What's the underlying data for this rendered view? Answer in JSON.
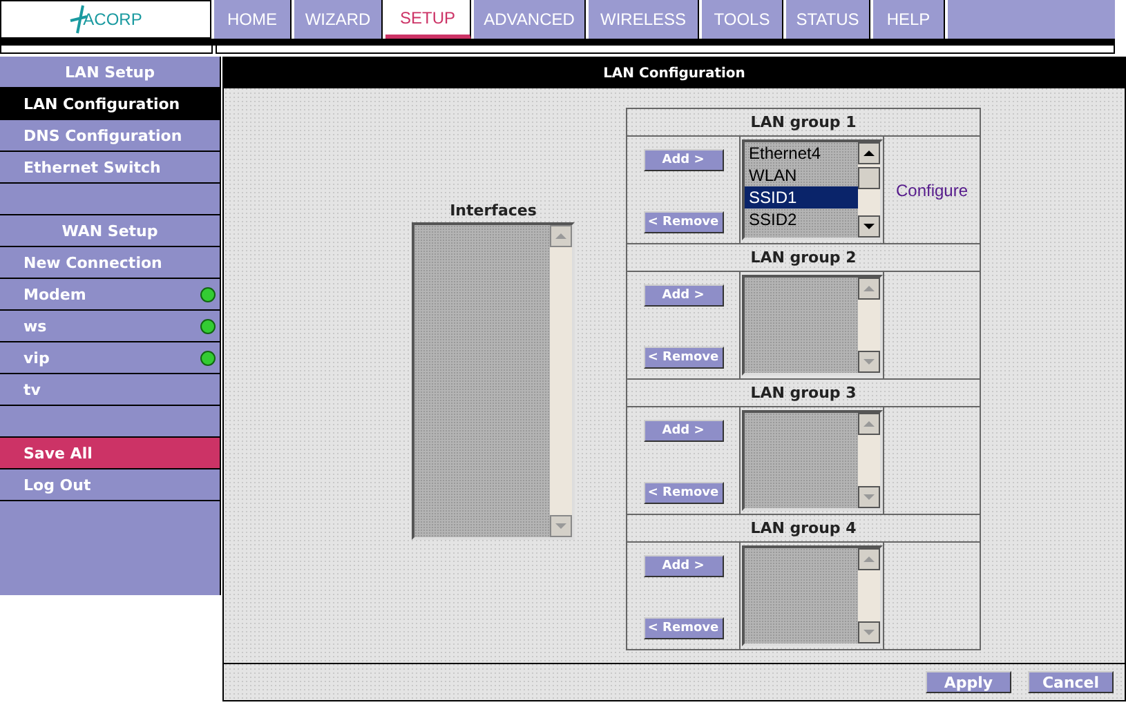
{
  "logo": {
    "text": "ACORP"
  },
  "nav": [
    {
      "label": "HOME",
      "selected": false
    },
    {
      "label": "WIZARD",
      "selected": false
    },
    {
      "label": "SETUP",
      "selected": true
    },
    {
      "label": "ADVANCED",
      "selected": false
    },
    {
      "label": "WIRELESS",
      "selected": false
    },
    {
      "label": "TOOLS",
      "selected": false
    },
    {
      "label": "STATUS",
      "selected": false
    },
    {
      "label": "HELP",
      "selected": false
    }
  ],
  "sidebar": {
    "items": [
      {
        "kind": "header",
        "label": "LAN Setup"
      },
      {
        "kind": "item",
        "label": "LAN Configuration",
        "selected": true,
        "online": false
      },
      {
        "kind": "item",
        "label": "DNS Configuration",
        "selected": false,
        "online": false
      },
      {
        "kind": "item",
        "label": "Ethernet Switch",
        "selected": false,
        "online": false
      },
      {
        "kind": "blank"
      },
      {
        "kind": "header",
        "label": "WAN Setup"
      },
      {
        "kind": "item",
        "label": "New Connection",
        "selected": false,
        "online": false
      },
      {
        "kind": "item",
        "label": "Modem",
        "selected": false,
        "online": true
      },
      {
        "kind": "item",
        "label": "ws",
        "selected": false,
        "online": true
      },
      {
        "kind": "item",
        "label": "vip",
        "selected": false,
        "online": true
      },
      {
        "kind": "item",
        "label": "tv",
        "selected": false,
        "online": false
      },
      {
        "kind": "blank"
      },
      {
        "kind": "save",
        "label": "Save All"
      },
      {
        "kind": "item",
        "label": "Log Out",
        "selected": false,
        "online": false
      }
    ]
  },
  "panel": {
    "title": "LAN Configuration",
    "interfaces": {
      "label": "Interfaces"
    },
    "groups": [
      {
        "title": "LAN group 1",
        "add": "Add >",
        "remove": "< Remove",
        "link": "Configure",
        "items": [
          {
            "label": "Ethernet4",
            "selected": false
          },
          {
            "label": "WLAN",
            "selected": false
          },
          {
            "label": "SSID1",
            "selected": true
          },
          {
            "label": "SSID2",
            "selected": false
          }
        ]
      },
      {
        "title": "LAN group 2",
        "add": "Add >",
        "remove": "< Remove"
      },
      {
        "title": "LAN group 3",
        "add": "Add >",
        "remove": "< Remove"
      },
      {
        "title": "LAN group 4",
        "add": "Add >",
        "remove": "< Remove"
      }
    ],
    "buttons": [
      "Apply",
      "Cancel"
    ]
  }
}
